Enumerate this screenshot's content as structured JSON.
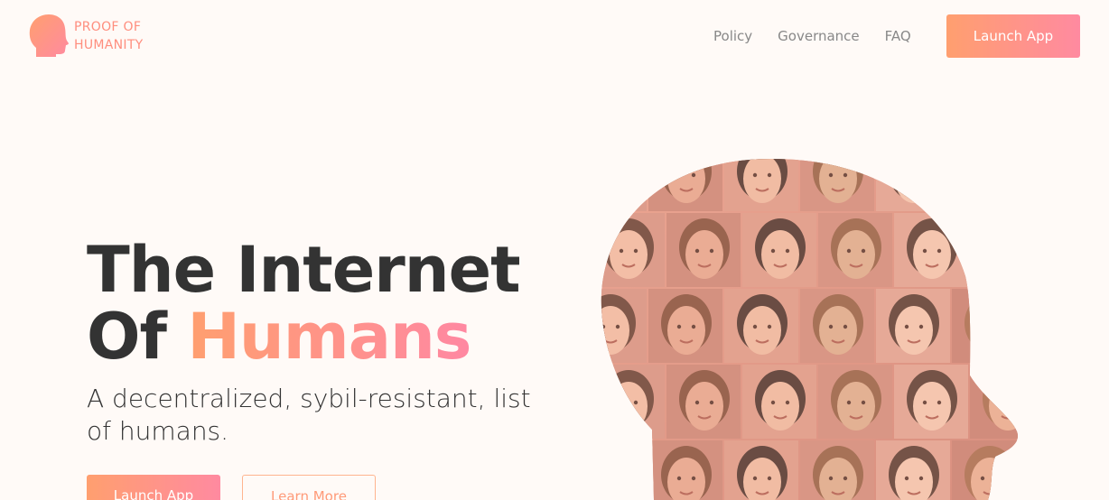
{
  "brand": {
    "logo_line1": "PROOF OF",
    "logo_line2": "HUMANITY",
    "logo_icon": "head-profile-icon",
    "accent_start": "#ff9f6f",
    "accent_end": "#ff8aa0"
  },
  "nav": {
    "links": [
      "Policy",
      "Governance",
      "FAQ"
    ],
    "cta_label": "Launch App"
  },
  "hero": {
    "title_line1": "The Internet",
    "title_line2_prefix": "Of ",
    "title_line2_highlight": "Humans",
    "subtitle": "A decentralized, sybil-resistant, list of humans.",
    "primary_button": "Launch App",
    "secondary_button": "Learn More"
  },
  "illustration": {
    "name": "head-silhouette-faces-collage"
  }
}
